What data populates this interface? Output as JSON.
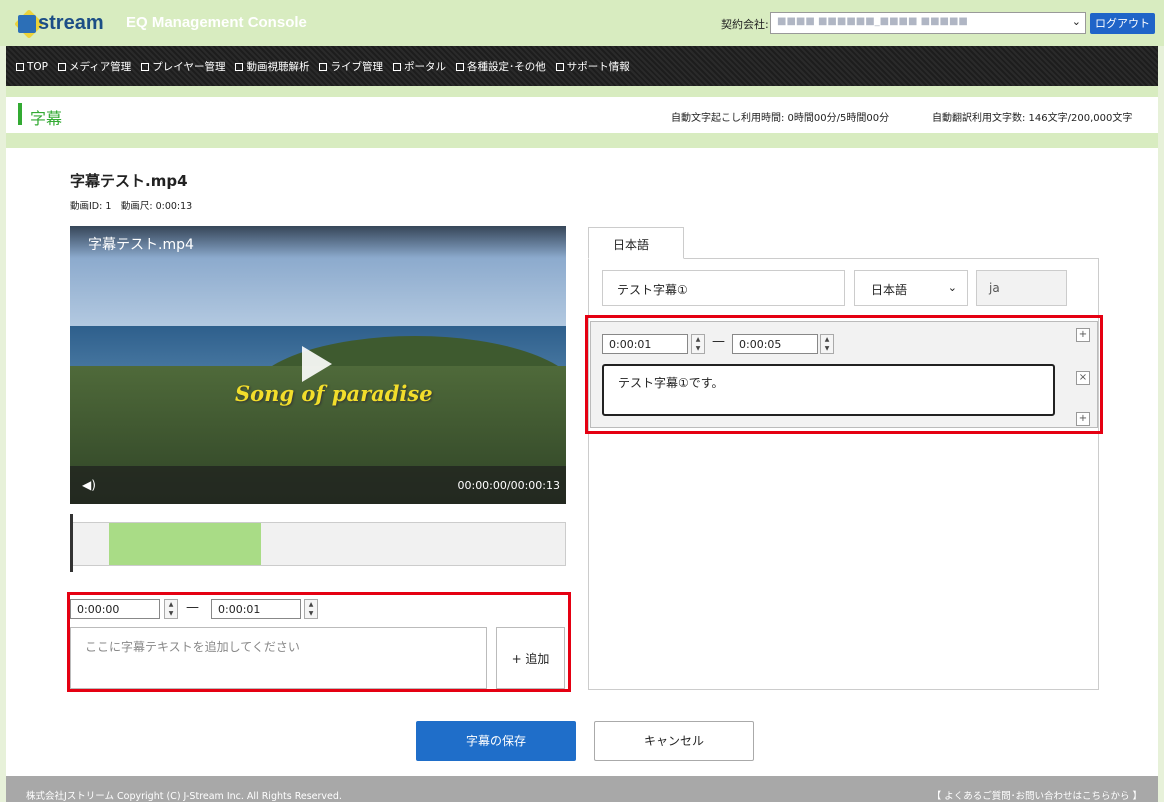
{
  "header": {
    "logo_text": "stream",
    "console_title": "EQ Management Console",
    "company_label": "契約会社:",
    "company_value": "■■■■ ■■■■■■_■■■■ ■■■■■",
    "logout_label": "ログアウト"
  },
  "nav": {
    "items": [
      {
        "label": "TOP"
      },
      {
        "label": "メディア管理"
      },
      {
        "label": "プレイヤー管理"
      },
      {
        "label": "動画視聴解析"
      },
      {
        "label": "ライブ管理"
      },
      {
        "label": "ポータル"
      },
      {
        "label": "各種設定･その他"
      },
      {
        "label": "サポート情報"
      }
    ]
  },
  "page": {
    "title": "字幕",
    "usage_transcription": "自動文字起こし利用時間: 0時間00分/5時間00分",
    "usage_translation": "自動翻訳利用文字数: 146文字/200,000文字"
  },
  "media": {
    "file_title": "字幕テスト.mp4",
    "meta": "動画ID: 1　動画尺: 0:00:13",
    "video_title": "字幕テスト.mp4",
    "overlay_text": "Song of paradise",
    "video_time": "00:00:00/00:00:13"
  },
  "add_caption": {
    "start_time": "0:00:00",
    "end_time": "0:00:01",
    "separator": "—",
    "placeholder": "ここに字幕テキストを追加してください",
    "add_label": "+ 追加"
  },
  "panel": {
    "tab_label": "日本語",
    "caption_name": "テスト字幕①",
    "language": "日本語",
    "language_code": "ja",
    "entry": {
      "start_time": "0:00:01",
      "end_time": "0:00:05",
      "separator": "—",
      "text": "テスト字幕①です。"
    }
  },
  "buttons": {
    "save": "字幕の保存",
    "cancel": "キャンセル"
  },
  "footer": {
    "copyright": "株式会社Jストリーム  Copyright (C) J-Stream Inc. All Rights Reserved.",
    "faq": "【 よくあるご質問･お問い合わせはこちらから 】"
  },
  "colors": {
    "brand_green": "#33aa33",
    "accent_blue": "#1f6ec9",
    "highlight_red": "#e50012",
    "timeline_segment": "#a9dc86"
  }
}
